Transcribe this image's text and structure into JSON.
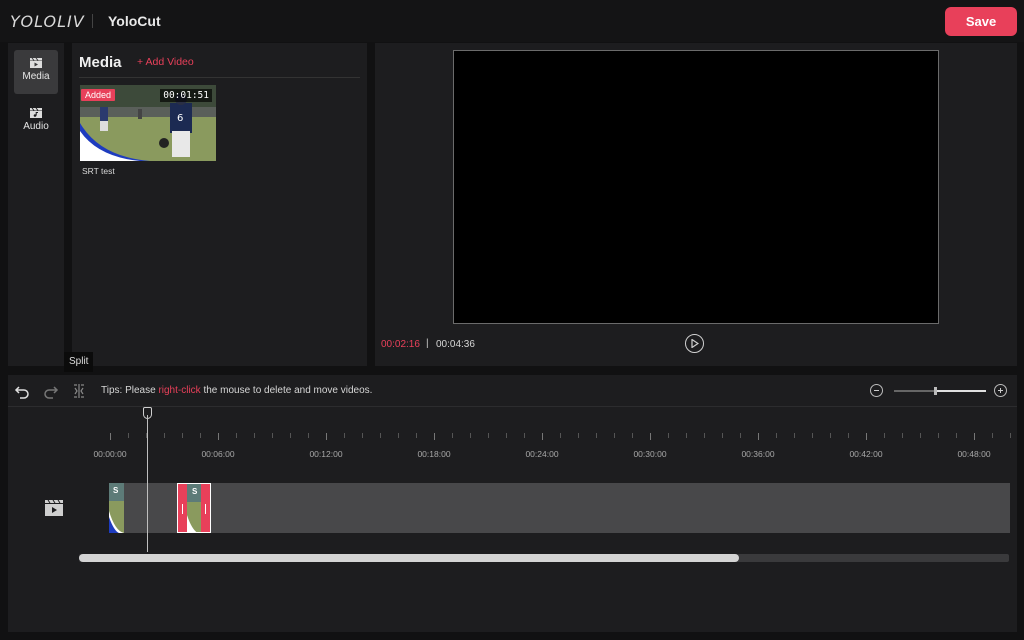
{
  "header": {
    "brand": "YOLOLIV",
    "app_title": "YoloCut",
    "save_label": "Save"
  },
  "sidebar": {
    "items": [
      {
        "label": "Media",
        "icon": "video-clapper-icon",
        "active": true
      },
      {
        "label": "Audio",
        "icon": "audio-clapper-icon",
        "active": false
      }
    ]
  },
  "media": {
    "title": "Media",
    "add_video_label": "+ Add Video",
    "items": [
      {
        "name": "SRT test",
        "duration": "00:01:51",
        "badge": "Added"
      }
    ]
  },
  "preview": {
    "current_time": "00:02:16",
    "separator": "|",
    "total_time": "00:04:36"
  },
  "tooltip": {
    "text": "Split"
  },
  "timeline": {
    "tips_prefix": "Tips: Please ",
    "tips_highlight": "right-click",
    "tips_suffix": " the mouse to delete and move videos.",
    "zoom_level": 0.45,
    "scroll_fraction": 0.71,
    "ruler_labels": [
      "00:00:00",
      "00:06:00",
      "00:12:00",
      "00:18:00",
      "00:24:00",
      "00:30:00",
      "00:36:00",
      "00:42:00",
      "00:48:00"
    ],
    "clips": [
      {
        "label": "S",
        "selected": false
      },
      {
        "label": "S",
        "selected": true
      }
    ]
  },
  "colors": {
    "accent": "#e8405a",
    "panel": "#1d1d1f",
    "background": "#111112"
  }
}
